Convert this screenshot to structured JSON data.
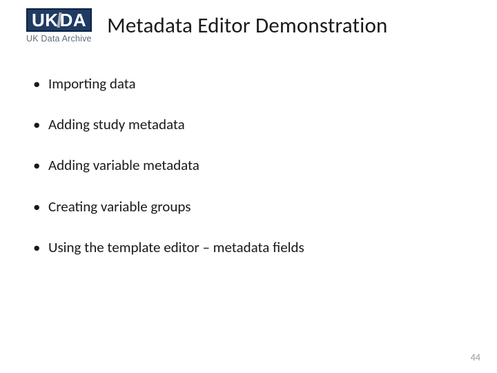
{
  "logo": {
    "text_left": "UK",
    "text_right": "DA",
    "subtitle": "UK Data Archive"
  },
  "title": "Metadata Editor Demonstration",
  "bullets": [
    "Importing data",
    "Adding study metadata",
    "Adding variable metadata",
    "Creating variable groups",
    "Using the template editor – metadata fields"
  ],
  "page_number": "44"
}
